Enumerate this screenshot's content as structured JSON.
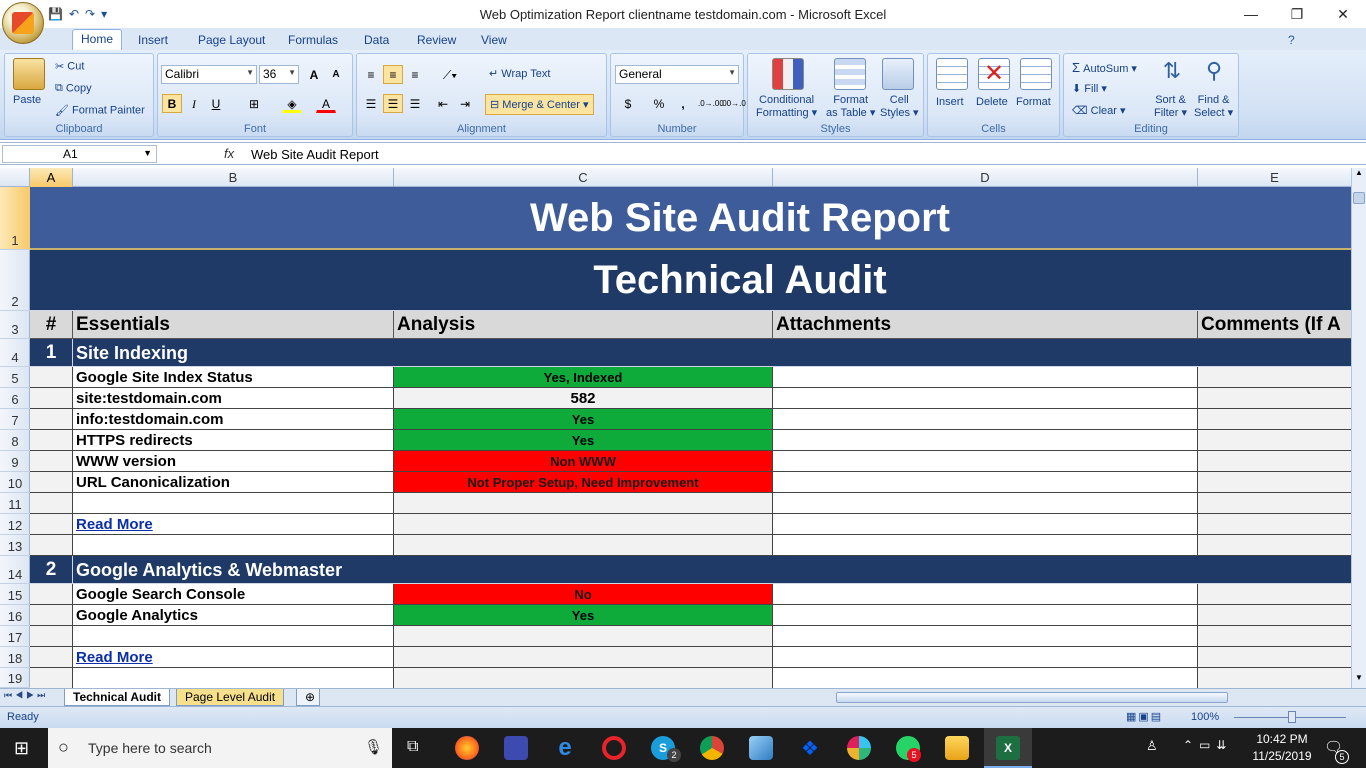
{
  "window": {
    "title": "Web Optimization Report clientname testdomain.com - Microsoft Excel",
    "minimize": "—",
    "restore": "❐",
    "close": "✕"
  },
  "qat": {
    "save": "💾",
    "undo": "↶",
    "redo": "↷",
    "more": "▾"
  },
  "tabs": [
    "Home",
    "Insert",
    "Page Layout",
    "Formulas",
    "Data",
    "Review",
    "View"
  ],
  "active_tab": "Home",
  "ribbon": {
    "clipboard": {
      "label": "Clipboard",
      "paste": "Paste",
      "cut": "Cut",
      "copy": "Copy",
      "format_painter": "Format Painter"
    },
    "font": {
      "label": "Font",
      "family": "Calibri",
      "size": "36",
      "grow": "A",
      "shrink": "A",
      "bold": "B",
      "italic": "I",
      "underline": "U"
    },
    "alignment": {
      "label": "Alignment",
      "wrap_text": "Wrap Text",
      "merge_center": "Merge & Center"
    },
    "number": {
      "label": "Number",
      "format": "General",
      "currency": "$",
      "percent": "%",
      "comma": ",",
      "inc_dec": ".0→.00",
      "dec_dec": ".00→.0"
    },
    "styles": {
      "label": "Styles",
      "conditional": "Conditional",
      "conditional2": "Formatting",
      "format_table": "Format",
      "format_table2": "as Table",
      "cell_styles": "Cell",
      "cell_styles2": "Styles"
    },
    "cells": {
      "label": "Cells",
      "insert": "Insert",
      "delete": "Delete",
      "format": "Format"
    },
    "editing": {
      "label": "Editing",
      "autosum": "AutoSum",
      "fill": "Fill",
      "clear": "Clear",
      "sort": "Sort &",
      "sort2": "Filter",
      "find": "Find &",
      "find2": "Select"
    }
  },
  "formula_bar": {
    "name_box": "A1",
    "fx": "fx",
    "content": "Web Site Audit Report"
  },
  "columns": [
    "A",
    "B",
    "C",
    "D",
    "E"
  ],
  "rows": [
    "1",
    "2",
    "3",
    "4",
    "5",
    "6",
    "7",
    "8",
    "9",
    "10",
    "11",
    "12",
    "13",
    "14",
    "15",
    "16",
    "17",
    "18",
    "19"
  ],
  "sheet": {
    "title": "Web Site Audit Report",
    "subtitle": "Technical Audit",
    "headers": {
      "num": "#",
      "essentials": "Essentials",
      "analysis": "Analysis",
      "attachments": "Attachments",
      "comments": "Comments (If A"
    },
    "section1": {
      "num": "1",
      "name": "Site Indexing"
    },
    "items1": [
      {
        "label": "Google Site Index Status",
        "value": "Yes, Indexed",
        "status": "green"
      },
      {
        "label": "site:testdomain.com",
        "value": "582",
        "status": "plain"
      },
      {
        "label": "info:testdomain.com",
        "value": "Yes",
        "status": "green"
      },
      {
        "label": "HTTPS redirects",
        "value": "Yes",
        "status": "green"
      },
      {
        "label": "WWW version",
        "value": "Non WWW",
        "status": "red"
      },
      {
        "label": "URL Canonicalization",
        "value": "Not Proper Setup, Need Improvement",
        "status": "red"
      }
    ],
    "read_more_1": "Read More",
    "section2": {
      "num": "2",
      "name": "Google Analytics & Webmaster"
    },
    "items2": [
      {
        "label": "Google Search Console",
        "value": "No",
        "status": "red"
      },
      {
        "label": "Google Analytics",
        "value": "Yes",
        "status": "green"
      }
    ],
    "read_more_2": "Read More"
  },
  "sheet_tabs": [
    "Technical Audit",
    "Page Level Audit"
  ],
  "status": {
    "ready": "Ready",
    "zoom": "100%"
  },
  "taskbar": {
    "search_placeholder": "Type here to search",
    "time": "10:42 PM",
    "date": "11/25/2019",
    "notifications": "5",
    "skype_badge": "2",
    "whatsapp_badge": "5"
  },
  "colors": {
    "green": "#0eaa3a",
    "red": "#ff0000",
    "navy": "#1f3a66",
    "blue": "#3e5c9a"
  }
}
